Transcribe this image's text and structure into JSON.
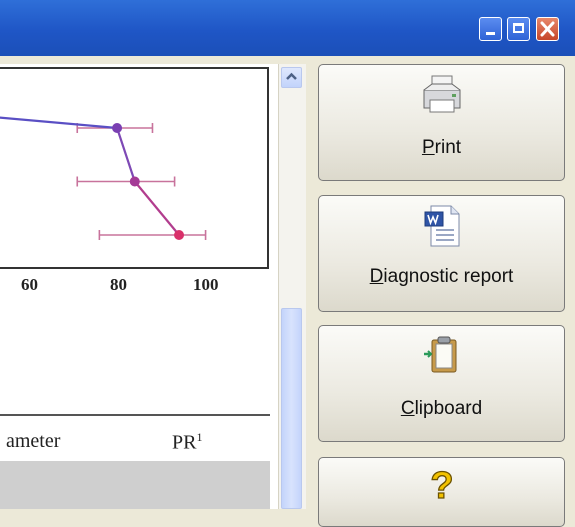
{
  "window": {
    "controls": [
      "minimize",
      "maximize",
      "close"
    ]
  },
  "chart_data": {
    "type": "scatter",
    "x_ticks": [
      "60",
      "80",
      "100"
    ],
    "xlim": [
      45,
      108
    ],
    "series": [
      {
        "points": [
          {
            "x": 79,
            "y": 3,
            "err_low": 70,
            "err_high": 87
          },
          {
            "x": 83,
            "y": 2,
            "err_low": 70,
            "err_high": 92
          },
          {
            "x": 93,
            "y": 1,
            "err_low": 75,
            "err_high": 99
          }
        ]
      }
    ],
    "line_segment_start": {
      "x": 45,
      "y": 3.25
    },
    "colors": {
      "line_start": "#5a4fc4",
      "line_end": "#d9306a",
      "error_bars": "#c8739c"
    }
  },
  "table": {
    "header_fragment": "ameter",
    "header_pr": "PR",
    "header_pr_sup": "1"
  },
  "sidebar": {
    "print_label": "Print",
    "print_hotkey": "P",
    "print_rest": "rint",
    "diagnostic_hotkey": "D",
    "diagnostic_rest": "iagnostic report",
    "clipboard_hotkey": "C",
    "clipboard_rest": "lipboard",
    "help_icon": "question-mark-icon"
  },
  "colors": {
    "titlebar": "#1f56c6",
    "close_button": "#d0553a",
    "scroll_thumb": "#c4d4fb"
  }
}
